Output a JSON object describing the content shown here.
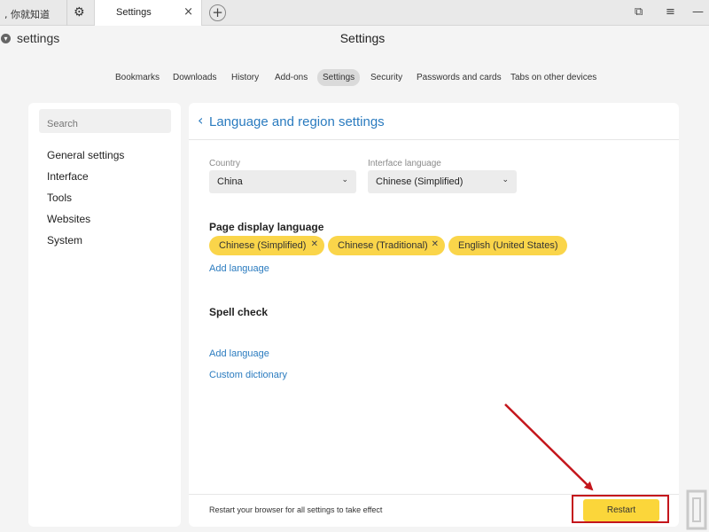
{
  "tabs": {
    "previous_tab_label": ", 你就知道",
    "active_tab_label": "Settings",
    "active_tab_close": "×",
    "new_tab": "+"
  },
  "window_controls": {
    "bookmarks_glyph": "⧉",
    "menu_glyph": "≡",
    "minimize_glyph": "—"
  },
  "address_bar": {
    "text": "settings",
    "page_title": "Settings"
  },
  "settings_nav": {
    "items": [
      "Bookmarks",
      "Downloads",
      "History",
      "Add-ons",
      "Settings",
      "Security",
      "Passwords and cards",
      "Tabs on other devices"
    ],
    "active": "Settings"
  },
  "sidebar": {
    "search_placeholder": "Search",
    "items": [
      "General settings",
      "Interface",
      "Tools",
      "Websites",
      "System"
    ]
  },
  "main": {
    "title": "Language and region settings",
    "country_label": "Country",
    "country_value": "China",
    "interface_language_label": "Interface language",
    "interface_language_value": "Chinese (Simplified)",
    "page_display_language_title": "Page display language",
    "languages": [
      "Chinese (Simplified)",
      "Chinese (Traditional)",
      "English (United States)"
    ],
    "add_language_link": "Add language",
    "spell_check_title": "Spell check",
    "spell_add_language_link": "Add language",
    "custom_dictionary_link": "Custom dictionary",
    "restart_notice": "Restart your browser for all settings to take effect",
    "restart_button": "Restart"
  },
  "colors": {
    "accent_link": "#2a7bbf",
    "chip_yellow": "#fad54a",
    "restart_button": "#fbd63a",
    "annotation_red": "#c4161c"
  }
}
